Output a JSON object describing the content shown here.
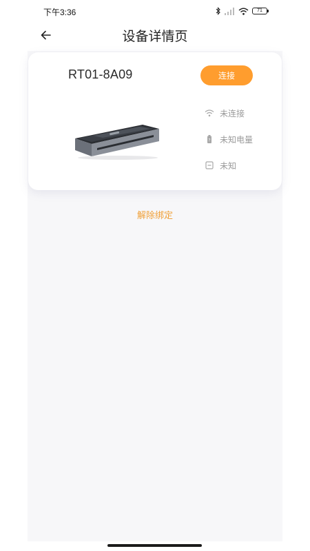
{
  "status_bar": {
    "time": "下午3:36",
    "battery_level": "71"
  },
  "nav": {
    "title": "设备详情页",
    "back_icon": "arrow-left-icon"
  },
  "device": {
    "name": "RT01-8A09",
    "connect_label": "连接",
    "info": {
      "connection_status": "未连接",
      "battery_status": "未知电量",
      "paper_status": "未知"
    }
  },
  "actions": {
    "unbind_label": "解除绑定"
  },
  "colors": {
    "accent": "#ff9d2e",
    "unbind_text": "#f0a038",
    "info_text": "#9a9a9a",
    "content_background": "#f7f7f9"
  }
}
